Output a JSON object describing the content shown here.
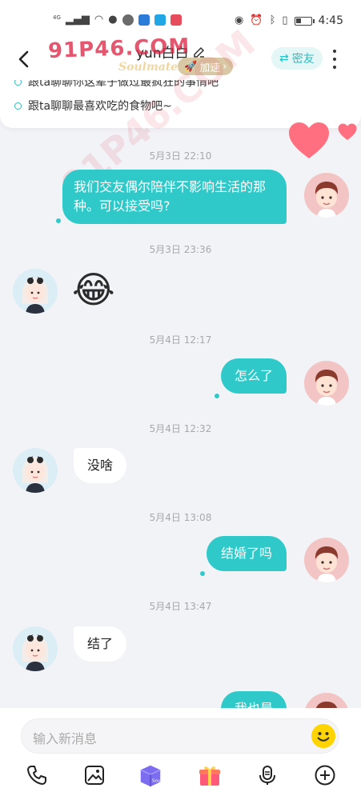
{
  "status_bar": {
    "network": "4G",
    "time": "4:45",
    "battery_level": 0.35
  },
  "header": {
    "contact_name": "yun白白",
    "subtitle": "Soulmate",
    "speed_label": "加速",
    "mi_label": "密友"
  },
  "topics": {
    "items": [
      "跟ta聊聊你这辈子做过最疯狂的事情吧",
      "跟ta聊聊最喜欢吃的食物吧~"
    ]
  },
  "watermark": "91P46.COM",
  "messages": [
    {
      "time": "5月3日 22:10",
      "side": "out",
      "text": "我们交友偶尔陪伴不影响生活的那种。可以接受吗?"
    },
    {
      "time": "5月3日 23:36",
      "side": "in",
      "text": "😂"
    },
    {
      "time": "5月4日 12:17",
      "side": "out",
      "text": "怎么了"
    },
    {
      "time": "5月4日 12:32",
      "side": "in",
      "text": "没啥"
    },
    {
      "time": "5月4日 13:08",
      "side": "out",
      "text": "结婚了吗"
    },
    {
      "time": "5月4日 13:47",
      "side": "in",
      "text": "结了"
    },
    {
      "time": "",
      "side": "out",
      "text": "我也是"
    }
  ],
  "input": {
    "placeholder": "输入新消息"
  },
  "toolbar": {
    "box_label": "Soul"
  },
  "colors": {
    "accent": "#2fc9c9",
    "watermark": "#dc2846",
    "heart": "#ff6f7f"
  }
}
